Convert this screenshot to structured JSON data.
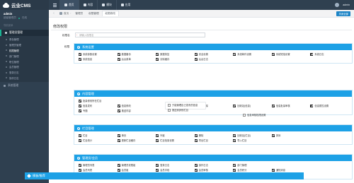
{
  "app": {
    "brand": "云业CMS"
  },
  "user": {
    "name": "admin",
    "role": "超级管理员",
    "status": "在线"
  },
  "sidebar": {
    "caption": "导航菜单",
    "active_menu": "管理员管理",
    "submenu": [
      "角色管理",
      "管理员管理",
      "权限管理",
      "部门管理",
      "职位管理",
      "会员管理",
      "登录日志",
      "操作日志"
    ],
    "current_sub_index": 2,
    "items": [
      "系统管理"
    ]
  },
  "topnav": [
    {
      "label": "首页"
    },
    {
      "label": "内容"
    },
    {
      "label": "模块"
    },
    {
      "label": "应用"
    }
  ],
  "topright": {
    "user": "admin"
  },
  "breadcrumb": {
    "home": "首页",
    "tabs": [
      "管理员",
      "权限管理",
      "权限修改"
    ],
    "active_tab_index": 2,
    "right_button": "关闭全部"
  },
  "form": {
    "title": "修改权限",
    "rolename_label": "权限名",
    "rolename_placeholder": "请输入权限名",
    "perm_label": "权限"
  },
  "panels": [
    {
      "title": "系统设置",
      "items": [
        {
          "label": "系统参数设置",
          "checked": true
        },
        {
          "label": "数据备份",
          "checked": true
        },
        {
          "label": "数据恢复",
          "checked": true
        },
        {
          "label": "安全设置",
          "checked": true
        },
        {
          "label": "系统邮件设置",
          "checked": true
        },
        {
          "label": "系统短信设置",
          "checked": true
        },
        {
          "label": "系统日志",
          "checked": true
        },
        {
          "label": "系统信息",
          "checked": true
        },
        {
          "label": "后台菜单",
          "checked": true
        },
        {
          "label": "清除缓存",
          "checked": true
        },
        {
          "label": "后台日志",
          "checked": true
        }
      ]
    },
    {
      "title": "内容管理",
      "items": [
        {
          "label": "批量修改所在栏目",
          "checked": true
        },
        {
          "label": "",
          "checked": false
        },
        {
          "label": "",
          "checked": false
        },
        {
          "label": "",
          "checked": false
        },
        {
          "label": "",
          "checked": false
        },
        {
          "label": "",
          "checked": false
        },
        {
          "label": "",
          "checked": false
        },
        {
          "label": "信息发布",
          "checked": true
        },
        {
          "label": "信息修改",
          "checked": true
        },
        {
          "label": "",
          "checked": false
        },
        {
          "label": "信息删除",
          "checked": true
        },
        {
          "label": "回收站(信息)",
          "checked": true
        },
        {
          "label": "信息批量审核",
          "checked": true
        },
        {
          "label": "信息属性设置",
          "checked": true
        },
        {
          "label": "专题",
          "checked": true
        },
        {
          "label": "推送内容",
          "checked": true
        },
        {
          "label": "",
          "checked": false
        },
        {
          "label": "",
          "checked": false
        },
        {
          "label": "",
          "checked": false
        },
        {
          "label": "",
          "checked": false
        },
        {
          "label": "",
          "checked": false
        }
      ],
      "extra": [
        {
          "label": "只能管理自己发布的信息"
        },
        {
          "label": "推送到其他栏目"
        },
        {
          "label": "信息审核权限设置"
        }
      ]
    },
    {
      "title": "栏目管理",
      "items": [
        {
          "label": "栏目",
          "checked": true
        },
        {
          "label": "单页",
          "checked": true
        },
        {
          "label": "外链",
          "checked": true
        },
        {
          "label": "删除",
          "checked": true
        },
        {
          "label": "回收站(栏目)",
          "checked": true
        },
        {
          "label": "排序",
          "checked": true
        },
        {
          "label": "",
          "checked": false
        },
        {
          "label": "栏目统计",
          "checked": true
        },
        {
          "label": "更新栏目缓存",
          "checked": true
        },
        {
          "label": "栏目批量设置",
          "checked": true
        },
        {
          "label": "导出栏目",
          "checked": true
        },
        {
          "label": "导入栏目",
          "checked": true
        },
        {
          "label": "",
          "checked": false
        },
        {
          "label": "",
          "checked": false
        }
      ]
    },
    {
      "title": "管理员/会员",
      "items": [
        {
          "label": "管理员列表",
          "checked": true
        },
        {
          "label": "管理员权限组",
          "checked": true
        },
        {
          "label": "登录日志",
          "checked": true
        },
        {
          "label": "操作日志",
          "checked": true
        },
        {
          "label": "部门管理",
          "checked": true
        },
        {
          "label": "",
          "checked": false
        },
        {
          "label": "",
          "checked": false
        },
        {
          "label": "会员列表",
          "checked": true
        },
        {
          "label": "会员组",
          "checked": true
        },
        {
          "label": "会员字段",
          "checked": true
        },
        {
          "label": "会员审核",
          "checked": true
        },
        {
          "label": "会员积分",
          "checked": true
        },
        {
          "label": "通知消息",
          "checked": true
        },
        {
          "label": "",
          "checked": false
        },
        {
          "label": "会员设置",
          "checked": true
        },
        {
          "label": "会员登录",
          "checked": true
        },
        {
          "label": "会员模型",
          "checked": true
        },
        {
          "label": "第三方登录管理",
          "checked": true
        },
        {
          "label": "会员空间",
          "checked": true
        },
        {
          "label": "",
          "checked": false
        },
        {
          "label": "",
          "checked": false
        }
      ]
    }
  ],
  "last_panel": {
    "title": "模板/推荐"
  },
  "colors": {
    "sidebar": "#2f4050",
    "accent": "#1da1e6",
    "active_green": "#1ab394"
  }
}
